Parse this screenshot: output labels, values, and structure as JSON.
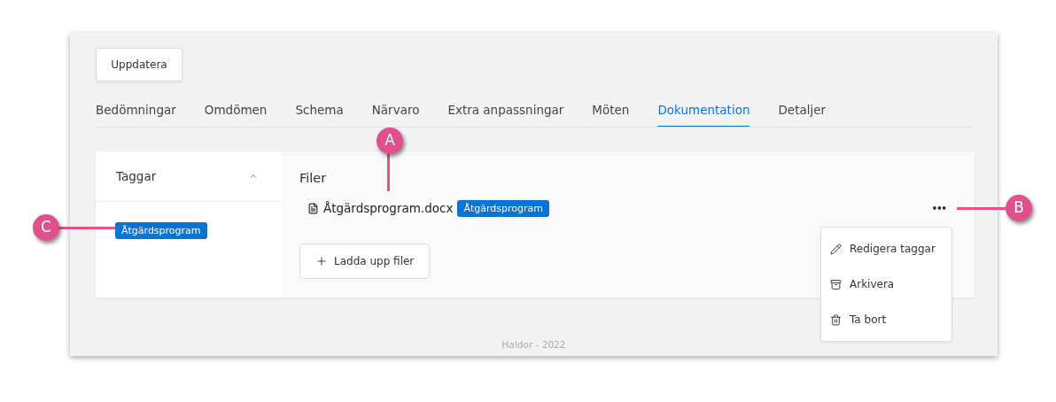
{
  "update_button": "Uppdatera",
  "tabs": [
    {
      "label": "Bedömningar",
      "selected": false
    },
    {
      "label": "Omdömen",
      "selected": false
    },
    {
      "label": "Schema",
      "selected": false
    },
    {
      "label": "Närvaro",
      "selected": false
    },
    {
      "label": "Extra anpassningar",
      "selected": false
    },
    {
      "label": "Möten",
      "selected": false
    },
    {
      "label": "Dokumentation",
      "selected": true
    },
    {
      "label": "Detaljer",
      "selected": false
    }
  ],
  "sidebar": {
    "title": "Taggar",
    "expanded": true,
    "tags": [
      "Åtgärdsprogram"
    ]
  },
  "files": {
    "title": "Filer",
    "items": [
      {
        "name": "Åtgärdsprogram.docx",
        "tags": [
          "Åtgärdsprogram"
        ]
      }
    ],
    "upload_button": "Ladda upp filer",
    "more_button": "•••"
  },
  "menu": [
    {
      "kind": "edit",
      "label": "Redigera taggar"
    },
    {
      "kind": "archive",
      "label": "Arkivera"
    },
    {
      "kind": "delete",
      "label": "Ta bort"
    }
  ],
  "footer": "Haldor - 2022",
  "callouts": [
    {
      "label": "A"
    },
    {
      "label": "B"
    },
    {
      "label": "C"
    }
  ]
}
